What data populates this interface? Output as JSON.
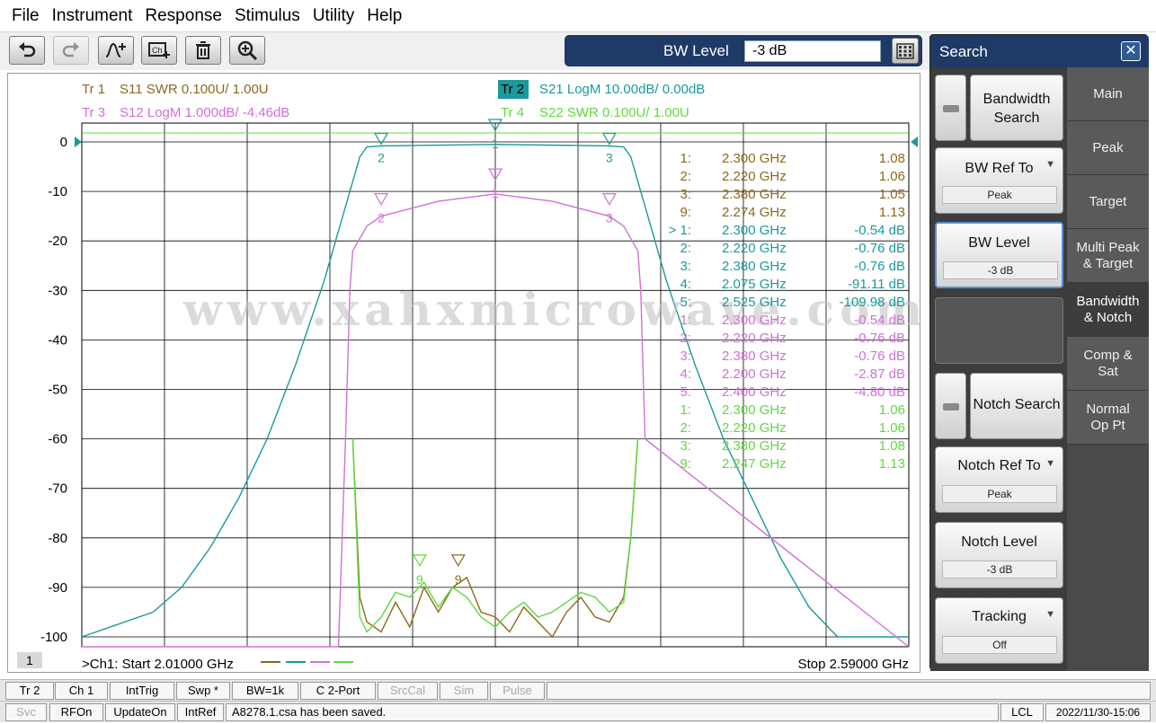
{
  "menu": [
    "File",
    "Instrument",
    "Response",
    "Stimulus",
    "Utility",
    "Help"
  ],
  "toolbar": {
    "buttons": [
      "undo-icon",
      "redo-icon",
      "add-trace-icon",
      "channel-icon",
      "delete-icon",
      "zoom-icon"
    ]
  },
  "bw_entry": {
    "label": "BW Level",
    "value": "-3 dB"
  },
  "traces": [
    {
      "id": "Tr 1",
      "text": "S11 SWR 0.100U/  1.00U",
      "color": "#8a6a1a"
    },
    {
      "id": "Tr 2",
      "text": "S21 LogM 10.00dB/  0.00dB",
      "color": "#1a9a9a",
      "active": true
    },
    {
      "id": "Tr 3",
      "text": "S12 LogM 1.000dB/  -4.46dB",
      "color": "#d070d8"
    },
    {
      "id": "Tr 4",
      "text": "S22 SWR 0.100U/  1.00U",
      "color": "#60d840"
    }
  ],
  "chart_data": {
    "type": "line",
    "x_start_ghz": 2.01,
    "x_stop_ghz": 2.59,
    "y_ticks": [
      "0",
      "-10",
      "-20",
      "-30",
      "-40",
      "-50",
      "-60",
      "-70",
      "-80",
      "-90",
      "-100"
    ],
    "ylim": [
      -102,
      2
    ],
    "grid": true,
    "channel_label": ">Ch1:  Start   2.01000 GHz",
    "stop_label": "Stop  2.59000 GHz",
    "channel_number": "1",
    "watermark": "www.xahxmicrowave.com",
    "series": [
      {
        "name": "S21",
        "color": "#1a9a9a",
        "x": [
          2.01,
          2.06,
          2.08,
          2.1,
          2.12,
          2.14,
          2.16,
          2.18,
          2.19,
          2.2,
          2.205,
          2.21,
          2.22,
          2.3,
          2.38,
          2.39,
          2.395,
          2.4,
          2.41,
          2.42,
          2.44,
          2.46,
          2.48,
          2.5,
          2.52,
          2.54,
          2.59
        ],
        "y": [
          -100,
          -95,
          -90,
          -82,
          -72,
          -60,
          -45,
          -28,
          -18,
          -8,
          -3,
          -1,
          -0.8,
          -0.5,
          -0.8,
          -1,
          -3,
          -8,
          -18,
          -28,
          -45,
          -60,
          -72,
          -84,
          -94,
          -100,
          -100
        ]
      },
      {
        "name": "S12",
        "color": "#d070d8",
        "x": [
          2.01,
          2.19,
          2.195,
          2.198,
          2.2,
          2.21,
          2.22,
          2.26,
          2.3,
          2.34,
          2.38,
          2.39,
          2.4,
          2.402,
          2.405,
          2.59
        ],
        "y": [
          -102,
          -102,
          -60,
          -30,
          -22,
          -17,
          -15,
          -12,
          -10.5,
          -12,
          -15,
          -17,
          -22,
          -30,
          -60,
          -102
        ]
      },
      {
        "name": "S11",
        "color": "#8a6a1a",
        "x": [
          2.2,
          2.205,
          2.21,
          2.22,
          2.23,
          2.24,
          2.25,
          2.26,
          2.27,
          2.28,
          2.29,
          2.3,
          2.31,
          2.32,
          2.33,
          2.34,
          2.35,
          2.36,
          2.37,
          2.38,
          2.39,
          2.395,
          2.4
        ],
        "y": [
          -60,
          -92,
          -97,
          -99,
          -93,
          -98,
          -90,
          -95,
          -90,
          -88,
          -95,
          -96,
          -99,
          -94,
          -97,
          -100,
          -95,
          -92,
          -96,
          -97,
          -92,
          -80,
          -60
        ]
      },
      {
        "name": "S22",
        "color": "#60d840",
        "x": [
          2.2,
          2.205,
          2.21,
          2.22,
          2.23,
          2.24,
          2.25,
          2.26,
          2.27,
          2.28,
          2.29,
          2.3,
          2.31,
          2.32,
          2.33,
          2.34,
          2.35,
          2.36,
          2.37,
          2.38,
          2.39,
          2.395,
          2.4
        ],
        "y": [
          -60,
          -96,
          -99,
          -96,
          -91,
          -92,
          -89,
          -94,
          -90,
          -92,
          -96,
          -98,
          -95,
          -93,
          -96,
          -95,
          -93,
          -91,
          -92,
          -95,
          -93,
          -80,
          -60
        ]
      }
    ],
    "markers_table": [
      {
        "n": "1:",
        "freq": "2.300",
        "unit": "GHz",
        "val": "1.08",
        "color": "#8a6a1a"
      },
      {
        "n": "2:",
        "freq": "2.220",
        "unit": "GHz",
        "val": "1.06",
        "color": "#8a6a1a"
      },
      {
        "n": "3:",
        "freq": "2.380",
        "unit": "GHz",
        "val": "1.05",
        "color": "#8a6a1a"
      },
      {
        "n": "9:",
        "freq": "2.274",
        "unit": "GHz",
        "val": "1.13",
        "color": "#8a6a1a"
      },
      {
        "n": "> 1:",
        "freq": "2.300",
        "unit": "GHz",
        "val": "-0.54 dB",
        "color": "#1a9a9a"
      },
      {
        "n": "2:",
        "freq": "2.220",
        "unit": "GHz",
        "val": "-0.76 dB",
        "color": "#1a9a9a"
      },
      {
        "n": "3:",
        "freq": "2.380",
        "unit": "GHz",
        "val": "-0.76 dB",
        "color": "#1a9a9a"
      },
      {
        "n": "4:",
        "freq": "2.075",
        "unit": "GHz",
        "val": "-91.11 dB",
        "color": "#1a9a9a"
      },
      {
        "n": "5:",
        "freq": "2.525",
        "unit": "GHz",
        "val": "-109.98 dB",
        "color": "#1a9a9a"
      },
      {
        "n": "1:",
        "freq": "2.300",
        "unit": "GHz",
        "val": "-0.54 dB",
        "color": "#d070d8"
      },
      {
        "n": "2:",
        "freq": "2.220",
        "unit": "GHz",
        "val": "-0.76 dB",
        "color": "#d070d8"
      },
      {
        "n": "3:",
        "freq": "2.380",
        "unit": "GHz",
        "val": "-0.76 dB",
        "color": "#d070d8"
      },
      {
        "n": "4:",
        "freq": "2.200",
        "unit": "GHz",
        "val": "-2.87 dB",
        "color": "#d070d8"
      },
      {
        "n": "5:",
        "freq": "2.400",
        "unit": "GHz",
        "val": "-4.80 dB",
        "color": "#d070d8"
      },
      {
        "n": "1:",
        "freq": "2.300",
        "unit": "GHz",
        "val": "1.06",
        "color": "#60d840"
      },
      {
        "n": "2:",
        "freq": "2.220",
        "unit": "GHz",
        "val": "1.06",
        "color": "#60d840"
      },
      {
        "n": "3:",
        "freq": "2.380",
        "unit": "GHz",
        "val": "1.08",
        "color": "#60d840"
      },
      {
        "n": "9:",
        "freq": "2.247",
        "unit": "GHz",
        "val": "1.13",
        "color": "#60d840"
      }
    ]
  },
  "side_panel": {
    "title": "Search",
    "buttons": {
      "bandwidth_search": "Bandwidth Search",
      "bw_ref_to": "BW Ref To",
      "bw_ref_value": "Peak",
      "bw_level": "BW Level",
      "bw_level_value": "-3 dB",
      "notch_search": "Notch Search",
      "notch_ref_to": "Notch Ref To",
      "notch_ref_value": "Peak",
      "notch_level": "Notch Level",
      "notch_level_value": "-3 dB",
      "tracking": "Tracking",
      "tracking_value": "Off"
    },
    "tabs": [
      "Main",
      "Peak",
      "Target",
      "Multi Peak & Target",
      "Bandwidth & Notch",
      "Comp & Sat",
      "Normal Op Pt"
    ]
  },
  "softkeys": [
    "Tr 2",
    "Ch 1",
    "IntTrig",
    "Swp *",
    "BW=1k",
    "C  2-Port",
    "SrcCal",
    "Sim",
    "Pulse"
  ],
  "status": {
    "items": [
      "Svc",
      "RFOn",
      "UpdateOn",
      "IntRef"
    ],
    "message": "A8278.1.csa has been saved.",
    "lcl": "LCL",
    "datetime": "2022/11/30-15:06"
  }
}
